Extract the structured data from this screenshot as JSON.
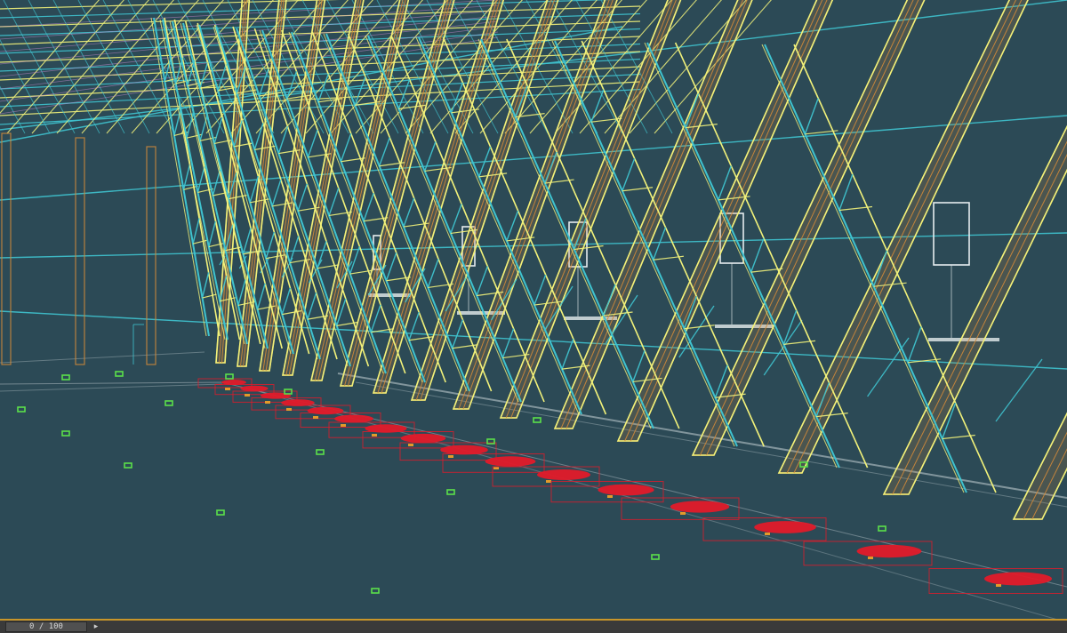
{
  "viewport": {
    "background": "#2c4a56",
    "colors": {
      "truss_yellow": "#f2f27a",
      "truss_cyan": "#3fc3cf",
      "column_orange": "#d08a3a",
      "footing_red": "#e21a2a",
      "marker_green": "#5be04a",
      "grid_white": "#c9d3d7"
    }
  },
  "statusbar": {
    "frame_counter": "0 / 100",
    "next_icon": "chevron-right-icon",
    "accent": "#c8962a"
  }
}
